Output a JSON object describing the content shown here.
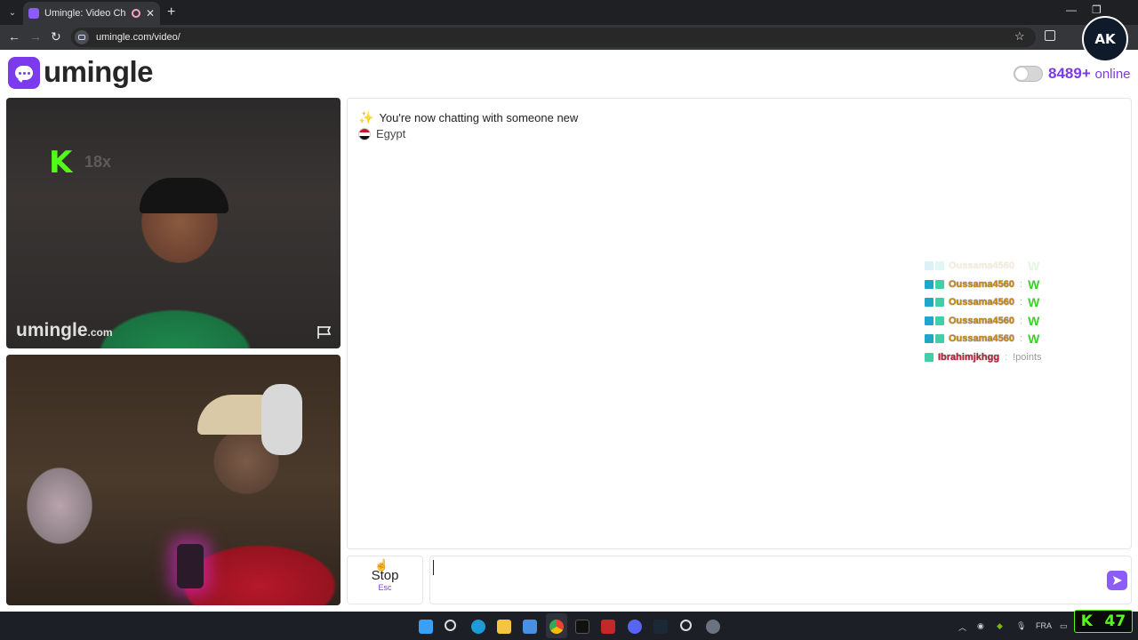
{
  "browser": {
    "tab_title": "Umingle: Video Chat with S",
    "tab_close": "✕",
    "new_tab": "+",
    "url": "umingle.com/video/"
  },
  "header": {
    "logo_text": "umingle",
    "online_count": "8489+",
    "online_label": "online"
  },
  "video": {
    "stranger_watermark": "umingle",
    "stranger_watermark_domain": ".com",
    "kick_overlay_icon": "K",
    "kick_overlay_multiplier": "18x"
  },
  "chat": {
    "system_message": "You're now chatting with someone new",
    "stranger_country": "Egypt",
    "stream_overlay": [
      {
        "user": "Oussama4560",
        "message": "W"
      },
      {
        "user": "Oussama4560",
        "message": "W"
      },
      {
        "user": "Oussama4560",
        "message": "W"
      },
      {
        "user": "Oussama4560",
        "message": "W"
      },
      {
        "user": "Oussama4560",
        "message": "W"
      },
      {
        "user": "Ibrahimjkhgg",
        "message": "!points"
      }
    ]
  },
  "controls": {
    "stop_label": "Stop",
    "stop_shortcut": "Esc",
    "message_value": ""
  },
  "taskbar": {
    "language": "FRA"
  },
  "stream": {
    "kick_counter_icon": "K",
    "kick_counter_value": "47",
    "channel_logo_text": "AK"
  },
  "colors": {
    "brand": "#7c3aed",
    "kick_green": "#53fc18"
  }
}
